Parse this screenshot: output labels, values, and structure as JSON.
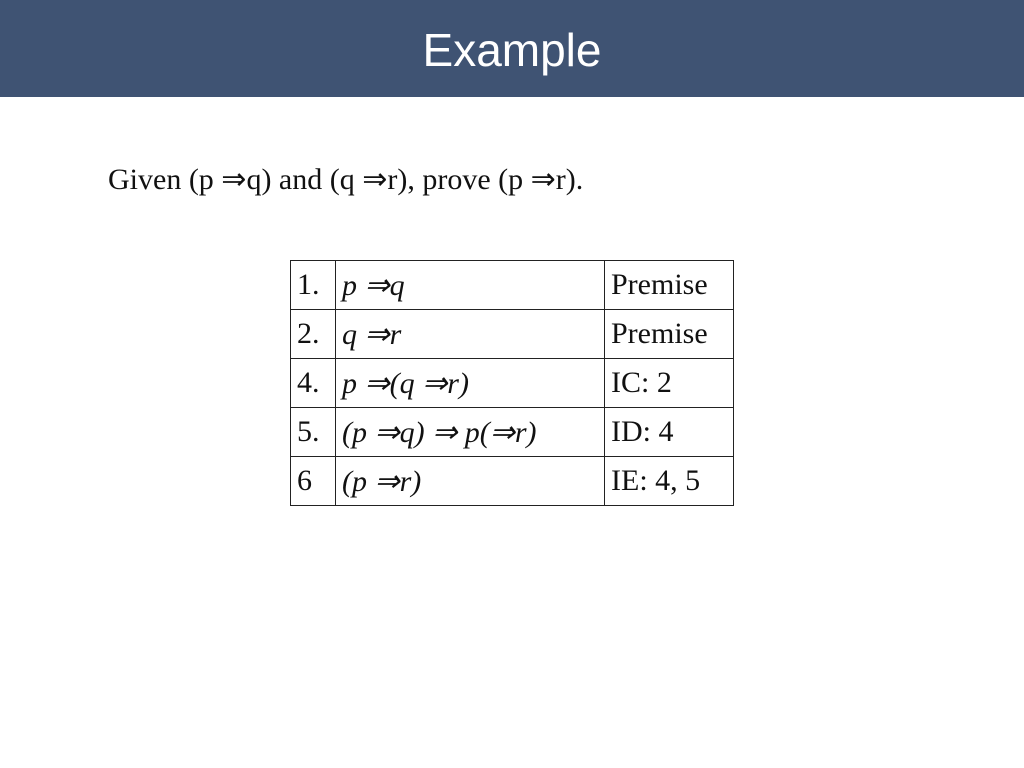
{
  "header": {
    "title": "Example",
    "background": "#3f5373"
  },
  "statement": "Given (p ⇒q) and (q ⇒r), prove (p ⇒r).",
  "proof": {
    "rows": [
      {
        "num": "1.",
        "expr": "p ⇒q",
        "justification": "Premise"
      },
      {
        "num": "2.",
        "expr": "q ⇒r",
        "justification": "Premise"
      },
      {
        "num": "4.",
        "expr": "p ⇒(q ⇒r)",
        "justification": "IC: 2"
      },
      {
        "num": "5.",
        "expr": "(p ⇒q) ⇒ p(⇒r)",
        "justification": "ID: 4"
      },
      {
        "num": "6",
        "expr": "(p ⇒r)",
        "justification": "IE: 4, 5"
      }
    ]
  }
}
